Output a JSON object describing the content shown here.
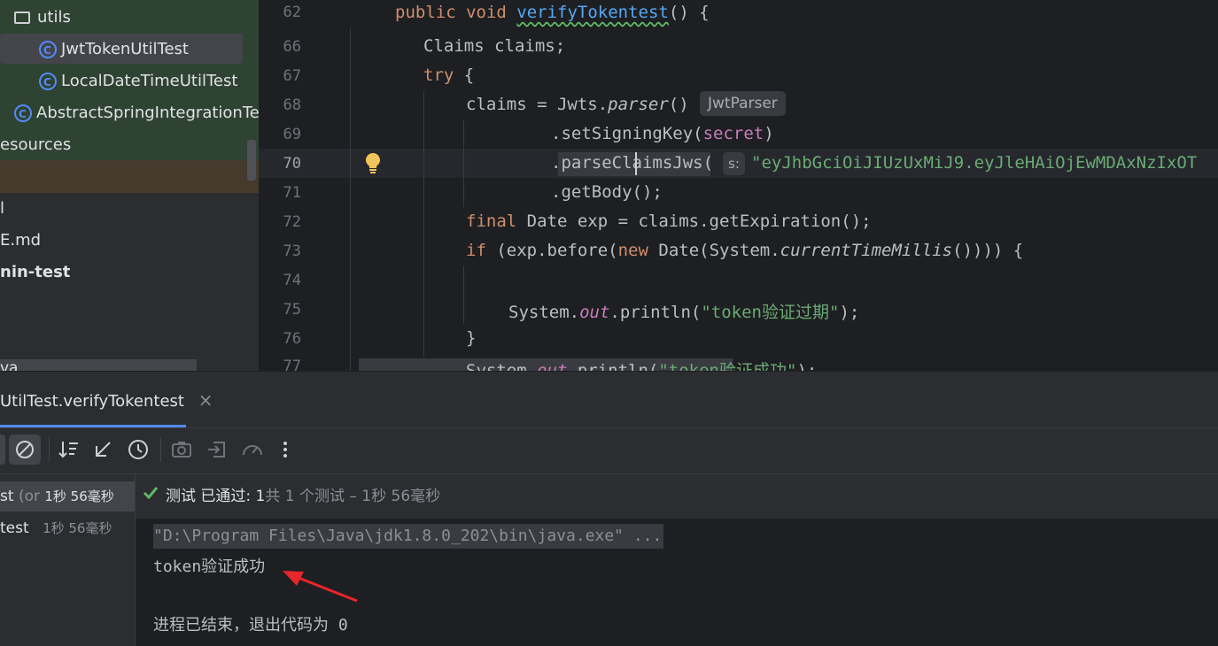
{
  "project_tree": {
    "utils_folder": "utils",
    "selected_file": "JwtTokenUtilTest",
    "file2": "LocalDateTimeUtilTest",
    "file3": "AbstractSpringIntegrationTest",
    "resources": "esources",
    "row_d": "l",
    "row_readme": "E.md",
    "row_module": "nin-test",
    "row_partial": "va"
  },
  "editor": {
    "lines": [
      {
        "num": "62"
      },
      {
        "num": "66"
      },
      {
        "num": "67"
      },
      {
        "num": "68"
      },
      {
        "num": "69"
      },
      {
        "num": "70"
      },
      {
        "num": "71"
      },
      {
        "num": "72"
      },
      {
        "num": "73"
      },
      {
        "num": "74"
      },
      {
        "num": "75"
      },
      {
        "num": "76"
      },
      {
        "num": "77"
      }
    ],
    "code": {
      "l62_kw": "public void ",
      "l62_fn": "verifyTokentest",
      "l62_rest": "() {",
      "l66": "Claims claims;",
      "l67_kw": "try",
      "l67_rest": " {",
      "l68_a": "claims = Jwts.",
      "l68_fn": "parser",
      "l68_b": "()",
      "l69_a": ".setSigningKey(",
      "l69_fld": "secret",
      "l69_b": ")",
      "l70_a": ".parseClaimsJws(",
      "l70_str": "\"eyJhbGciOiJIUzUxMiJ9.eyJleHAiOjEwMDAxNzIxOT",
      "l71": ".getBody();",
      "l72_kw": "final",
      "l72_rest": " Date exp = claims.getExpiration();",
      "l73_kw": "if",
      "l73_a": " (exp.before(",
      "l73_kw2": "new",
      "l73_b": " Date(System.",
      "l73_it": "currentTimeMillis",
      "l73_c": "()))) {",
      "l75_a": "System.",
      "l75_fld": "out",
      "l75_b": ".println(",
      "l75_str": "\"token验证过期\"",
      "l75_c": ");",
      "l76": "}",
      "l77_a": "System.",
      "l77_fld": "out",
      "l77_b": ".println(",
      "l77_str": "\"token验证成功\"",
      "l77_c": ");"
    },
    "hint_parser": "JwtParser",
    "hint_param": "s:"
  },
  "run_panel": {
    "tab_label": "UtilTest.verifyTokentest",
    "close_glyph": "×",
    "status_prefix": "测试 已通过: 1",
    "status_suffix": "共 1 个测试 – 1秒 56毫秒",
    "tree_root_name": "st",
    "tree_root_note": "(or",
    "tree_root_time": "1秒 56毫秒",
    "tree_child_name": "test",
    "tree_child_time": "1秒 56毫秒",
    "console_cmd": "\"D:\\Program Files\\Java\\jdk1.8.0_202\\bin\\java.exe\" ...",
    "console_output": "token验证成功",
    "console_exit": "进程已结束，退出代码为 0"
  },
  "colors": {
    "accent_green": "#5fb865",
    "arrow_red": "#e8262b"
  }
}
